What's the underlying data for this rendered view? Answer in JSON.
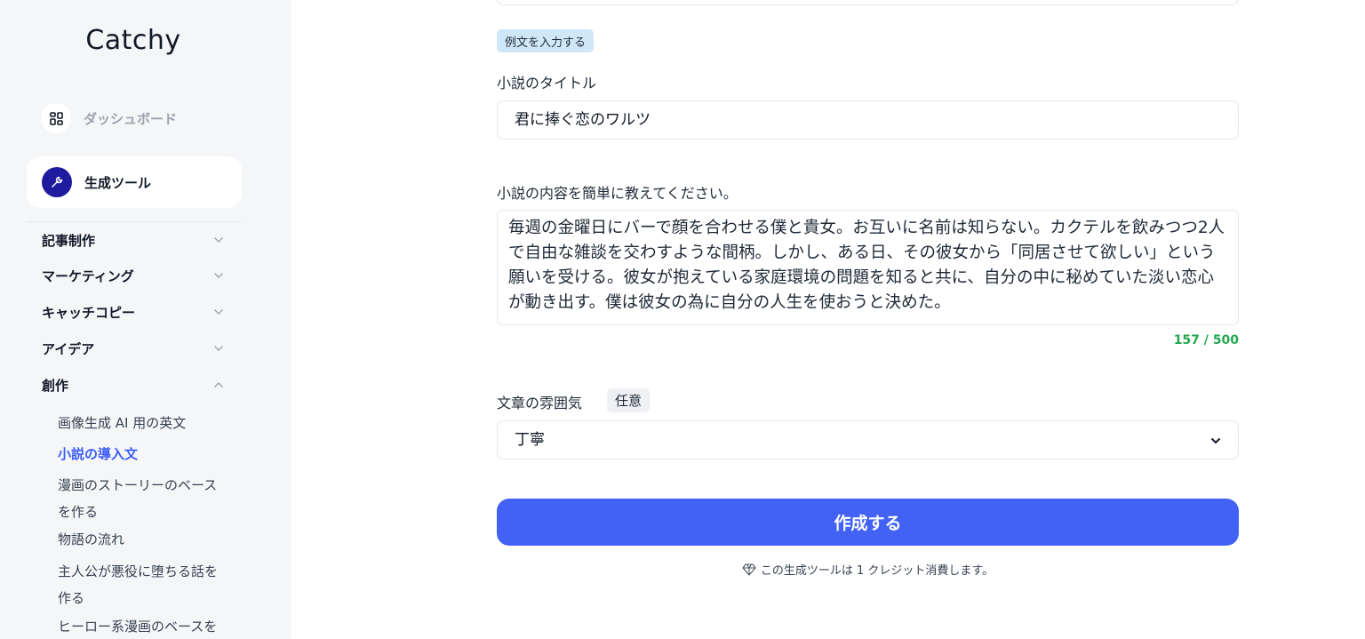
{
  "sidebar": {
    "logo": "Catchy",
    "dashboard_label": "ダッシュボード",
    "generator_label": "生成ツール",
    "categories": [
      {
        "label": "記事制作",
        "expanded": false
      },
      {
        "label": "マーケティング",
        "expanded": false
      },
      {
        "label": "キャッチコピー",
        "expanded": false
      },
      {
        "label": "アイデア",
        "expanded": false
      },
      {
        "label": "創作",
        "expanded": true
      }
    ],
    "subitems": [
      {
        "line1": "画像生成 AI 用の英文",
        "line2": ""
      },
      {
        "line1": "小説の導入文",
        "line2": "",
        "active": true
      },
      {
        "line1": "漫画のストーリーのベース",
        "line2": "を作る"
      },
      {
        "line1": "物語の流れ",
        "line2": ""
      },
      {
        "line1": "主人公が悪役に堕ちる話を",
        "line2": "作る"
      },
      {
        "line1": "ヒーロー系漫画のベースを",
        "line2": ""
      }
    ]
  },
  "form": {
    "example_badge": "例文を入力する",
    "title_label": "小説のタイトル",
    "title_value": "君に捧ぐ恋のワルツ",
    "content_label": "小説の内容を簡単に教えてください。",
    "content_value": "毎週の金曜日にバーで顔を合わせる僕と貴女。お互いに名前は知らない。カクテルを飲みつつ2人で自由な雑談を交わすような間柄。しかし、ある日、その彼女から「同居させて欲しい」という願いを受ける。彼女が抱えている家庭環境の問題を知ると共に、自分の中に秘めていた淡い恋心が動き出す。僕は彼女の為に自分の人生を使おうと決めた。",
    "counter": "157 / 500",
    "mood_label": "文章の雰囲気",
    "optional_badge": "任意",
    "mood_value": "丁寧",
    "submit_label": "作成する",
    "credit_note": "この生成ツールは 1 クレジット消費します。"
  },
  "colors": {
    "accent": "#4162f4",
    "active_link": "#3b5bf6",
    "counter": "#22a94f",
    "sidebar_bg": "#f5f6f8"
  }
}
